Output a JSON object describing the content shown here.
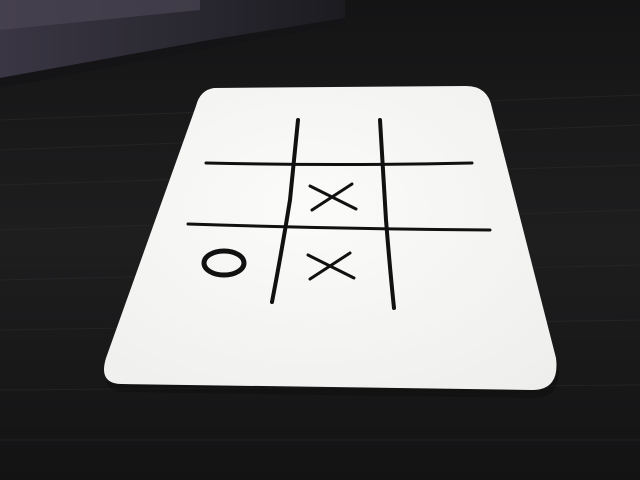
{
  "scene": {
    "colors": {
      "table_surface": "#1b1b1c",
      "table_grain": "#2a2a2b",
      "laptop_body": "#2c2a33",
      "laptop_glow": "#4a4552",
      "card": "#f6f6f4",
      "ink": "#111111"
    }
  },
  "board": {
    "rows": [
      [
        "",
        "",
        ""
      ],
      [
        "",
        "X",
        ""
      ],
      [
        "O",
        "X",
        ""
      ]
    ]
  }
}
